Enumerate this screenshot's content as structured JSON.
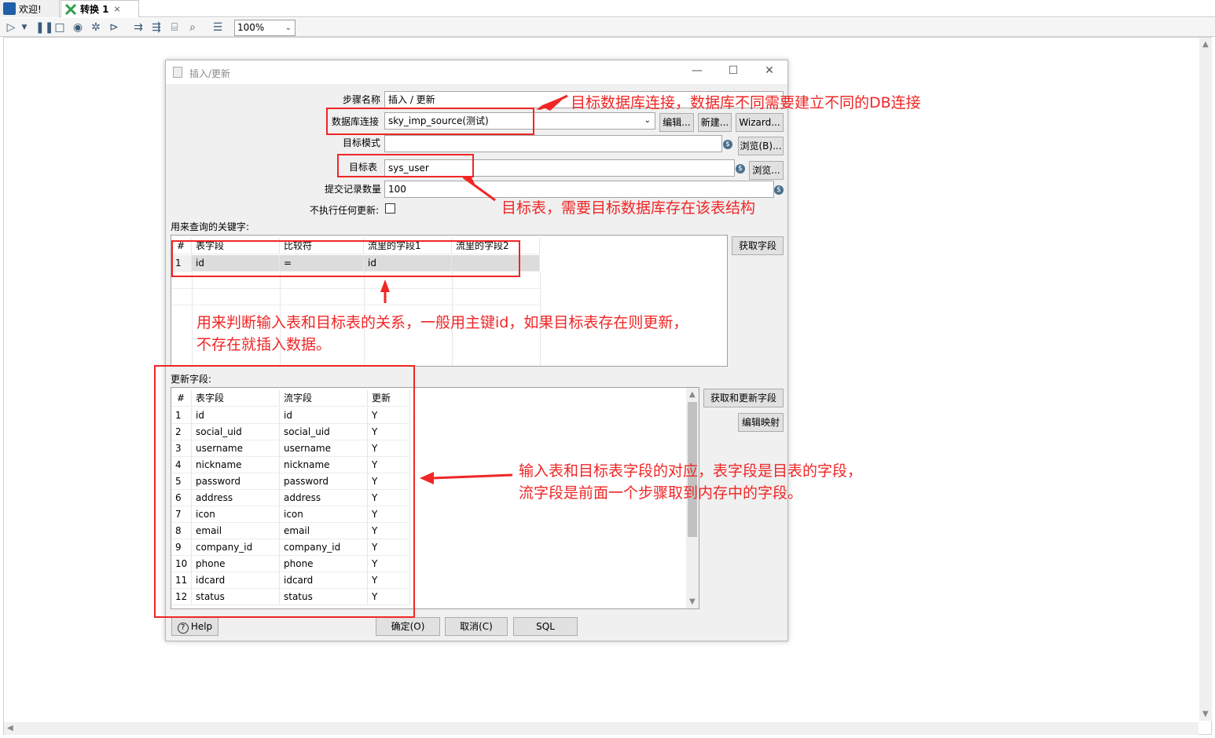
{
  "tabs": [
    {
      "label": "欢迎!",
      "icon": "spoon-icon"
    },
    {
      "label": "转换 1",
      "icon": "transformation-icon"
    }
  ],
  "toolbar": {
    "zoom": "100%"
  },
  "dialog": {
    "title": "插入/更新",
    "step_name_label": "步骤名称",
    "step_name_value": "插入 / 更新",
    "connection_label": "数据库连接",
    "connection_value": "sky_imp_source(测试)",
    "edit_button": "编辑...",
    "new_button": "新建...",
    "wizard_button": "Wizard...",
    "schema_label": "目标模式",
    "schema_value": "",
    "browse_b_button": "浏览(B)...",
    "table_label": "目标表",
    "table_value": "sys_user",
    "browse_button": "浏览...",
    "commit_label": "提交记录数量",
    "commit_value": "100",
    "no_update_label": "不执行任何更新:",
    "keys_label": "用来查询的关键字:",
    "get_fields_button": "获取字段",
    "keys_grid": {
      "headers": [
        "#",
        "表字段",
        "比较符",
        "流里的字段1",
        "流里的字段2"
      ],
      "rows": [
        [
          "1",
          "id",
          "=",
          "id",
          ""
        ]
      ]
    },
    "update_label": "更新字段:",
    "get_update_fields_button": "获取和更新字段",
    "edit_mapping_button": "编辑映射",
    "update_grid": {
      "headers": [
        "#",
        "表字段",
        "流字段",
        "更新"
      ],
      "rows": [
        [
          "1",
          "id",
          "id",
          "Y"
        ],
        [
          "2",
          "social_uid",
          "social_uid",
          "Y"
        ],
        [
          "3",
          "username",
          "username",
          "Y"
        ],
        [
          "4",
          "nickname",
          "nickname",
          "Y"
        ],
        [
          "5",
          "password",
          "password",
          "Y"
        ],
        [
          "6",
          "address",
          "address",
          "Y"
        ],
        [
          "7",
          "icon",
          "icon",
          "Y"
        ],
        [
          "8",
          "email",
          "email",
          "Y"
        ],
        [
          "9",
          "company_id",
          "company_id",
          "Y"
        ],
        [
          "10",
          "phone",
          "phone",
          "Y"
        ],
        [
          "11",
          "idcard",
          "idcard",
          "Y"
        ],
        [
          "12",
          "status",
          "status",
          "Y"
        ]
      ]
    },
    "help_button": "Help",
    "ok_button": "确定(O)",
    "cancel_button": "取消(C)",
    "sql_button": "SQL"
  },
  "annotations": {
    "connection_note": "目标数据库连接，数据库不同需要建立不同的DB连接",
    "table_note": "目标表，需要目标数据库存在该表结构",
    "keys_note_line1": "用来判断输入表和目标表的关系，一般用主键id，如果目标表存在则更新，",
    "keys_note_line2": "不存在就插入数据。",
    "fields_note_line1": "输入表和目标表字段的对应，表字段是目表的字段，",
    "fields_note_line2": "流字段是前面一个步骤取到内存中的字段。",
    "color": "#f02626"
  }
}
